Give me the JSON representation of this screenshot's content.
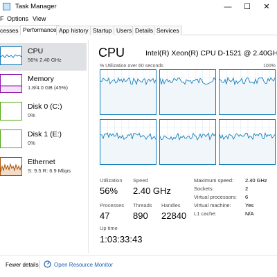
{
  "window": {
    "title": "Task Manager",
    "min": "—",
    "max": "☐",
    "close": "✕"
  },
  "menu": {
    "file": "F",
    "options": "Options",
    "view": "View"
  },
  "tabs": [
    "cesses",
    "Performance",
    "App history",
    "Startup",
    "Users",
    "Details",
    "Services"
  ],
  "sidebar": {
    "cpu": {
      "name": "CPU",
      "sub": "56% 2.40 GHz"
    },
    "memory": {
      "name": "Memory",
      "sub": "1.8/4.0 GB (45%)"
    },
    "disk0": {
      "name": "Disk 0 (C:)",
      "sub": "0%"
    },
    "disk1": {
      "name": "Disk 1 (E:)",
      "sub": "0%"
    },
    "ethernet": {
      "name": "Ethernet",
      "sub": "S: 9.5 R: 6.9 Mbps"
    }
  },
  "main": {
    "title": "CPU",
    "model": "Intel(R) Xeon(R) CPU D-1521 @ 2.40GHz",
    "graph_label": "% Utilization over 60 seconds",
    "graph_max": "100%",
    "stats": {
      "utilization_label": "Utilization",
      "utilization": "56%",
      "speed_label": "Speed",
      "speed": "2.40 GHz",
      "processes_label": "Processes",
      "processes": "47",
      "threads_label": "Threads",
      "threads": "890",
      "handles_label": "Handles",
      "handles": "22840",
      "uptime_label": "Up time",
      "uptime": "1:03:33:43"
    },
    "details": [
      {
        "label": "Maximum speed:",
        "value": "2.40 GHz"
      },
      {
        "label": "Sockets:",
        "value": "2"
      },
      {
        "label": "Virtual processors:",
        "value": "6"
      },
      {
        "label": "Virtual machine:",
        "value": "Yes"
      },
      {
        "label": "L1 cache:",
        "value": "N/A"
      }
    ]
  },
  "footer": {
    "fewer_details": "Fewer details",
    "open_monitor": "Open Resource Monitor"
  },
  "colors": {
    "cpu": "#117dbb",
    "memory": "#8b12ae",
    "disk": "#4da60c",
    "ethernet": "#a74f01",
    "selected_bg": "#dfe1e4",
    "link": "#1a5fb4"
  }
}
